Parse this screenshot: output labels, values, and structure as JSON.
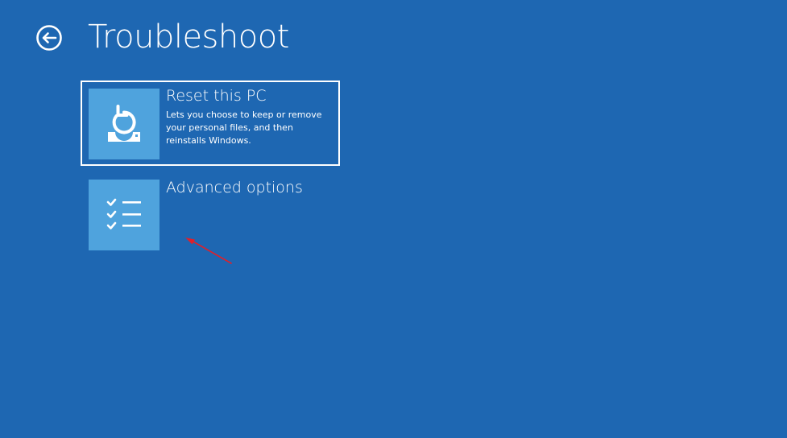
{
  "page": {
    "title": "Troubleshoot",
    "back_icon": "back-arrow-icon",
    "background_color": "#1e67b2",
    "tile_color": "#4fa3dd"
  },
  "options": [
    {
      "title": "Reset this PC",
      "description": "Lets you choose to keep or remove your personal files, and then reinstalls Windows.",
      "icon": "reset-pc-icon",
      "selected": true
    },
    {
      "title": "Advanced options",
      "description": "",
      "icon": "checklist-icon",
      "selected": false
    }
  ],
  "annotation": {
    "icon": "red-arrow-icon",
    "color": "#e0202a"
  }
}
